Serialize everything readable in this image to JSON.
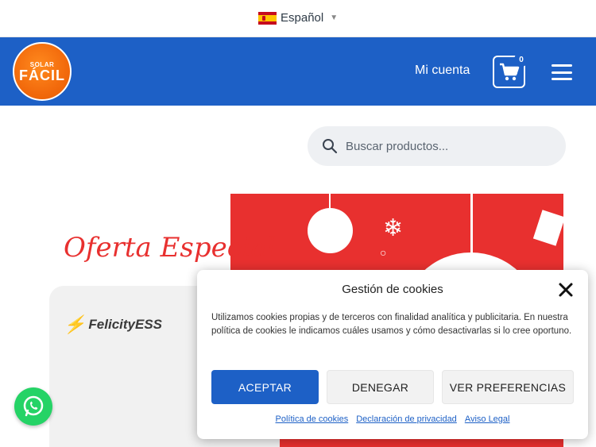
{
  "language": {
    "selected": "Español",
    "flag_icon": "spain-flag-icon"
  },
  "header": {
    "bg_color": "#1d60c6",
    "logo": {
      "line1": "SOLAR",
      "line2": "FÁCIL"
    },
    "account_label": "Mi cuenta",
    "cart_count": "0"
  },
  "search": {
    "placeholder": "Buscar productos..."
  },
  "banner": {
    "offer_text": "Oferta Especial",
    "brand_text": "FelicityESS",
    "accent_color": "#e8302f"
  },
  "cookie_dialog": {
    "title": "Gestión de cookies",
    "text": "Utilizamos cookies propias y de terceros con finalidad analítica y publicitaria. En nuestra política de cookies le indicamos cuáles usamos y cómo desactivarlas si lo cree oportuno.",
    "accept_label": "ACEPTAR",
    "deny_label": "DENEGAR",
    "prefs_label": "VER PREFERENCIAS",
    "links": [
      "Política de cookies",
      "Declaración de privacidad",
      "Aviso Legal"
    ]
  }
}
